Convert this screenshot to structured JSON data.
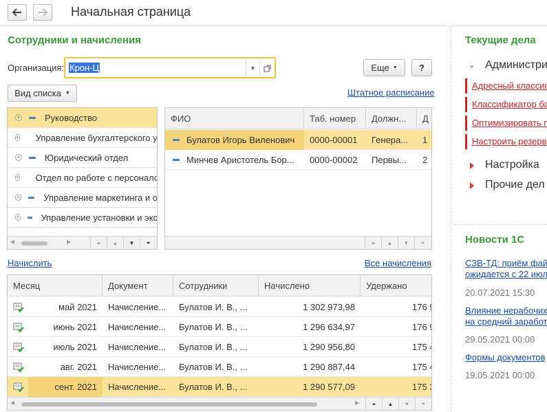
{
  "header": {
    "title": "Начальная страница"
  },
  "section": {
    "title": "Сотрудники и начисления"
  },
  "org": {
    "label": "Организация:",
    "value": "Крон-Ц"
  },
  "buttons": {
    "more": "Еще",
    "help": "?",
    "list_view": "Вид списка"
  },
  "links": {
    "staff_schedule": "Штатное расписание",
    "calculate": "Начислить",
    "all_accruals": "Все начисления"
  },
  "tree": {
    "items": [
      "Руководство",
      "Управление бухгалтерского учета",
      "Юридический отдел",
      "Отдел по работе с персоналом",
      "Управление маркетинга и о",
      "Управление установки и экс"
    ]
  },
  "employees": {
    "columns": [
      "ФИО",
      "Таб. номер",
      "Должн...",
      "Д"
    ],
    "rows": [
      {
        "name": "Булатов Игорь Виленович",
        "tab": "0000-00001",
        "pos": "Генера...",
        "d": "1"
      },
      {
        "name": "Минчев Аристотель Бор...",
        "tab": "0000-00002",
        "pos": "Первы...",
        "d": "2"
      }
    ]
  },
  "accruals": {
    "columns": [
      "Месяц",
      "Документ",
      "Сотрудники",
      "Начислено",
      "Удержано"
    ],
    "rows": [
      {
        "month": "май 2021",
        "doc": "Начисление...",
        "emp": "Булатов И. В., ...",
        "accrued": "1 302 973,98",
        "withheld": "176 9"
      },
      {
        "month": "июнь 2021",
        "doc": "Начисление...",
        "emp": "Булатов И. В., ...",
        "accrued": "1 296 634,97",
        "withheld": "176 9"
      },
      {
        "month": "июль 2021",
        "doc": "Начисление...",
        "emp": "Булатов И. В., ...",
        "accrued": "1 290 956,80",
        "withheld": "175 4"
      },
      {
        "month": "авг. 2021",
        "doc": "Начисление...",
        "emp": "Булатов И. В., ...",
        "accrued": "1 290 887,44",
        "withheld": "175 4"
      },
      {
        "month": "сент. 2021",
        "doc": "Начисление...",
        "emp": "Булатов И. В., ...",
        "accrued": "1 290 577,09",
        "withheld": "175 3"
      }
    ]
  },
  "current": {
    "title": "Текущие дела",
    "admin": "Администри",
    "admin_links": [
      "Адресный классис",
      "Классификатор ба",
      "Оптимизировать п",
      "Настроить резерв"
    ],
    "settings": "Настройка",
    "other": "Прочие дел"
  },
  "news": {
    "title": "Новости 1С",
    "items": [
      {
        "line1": "СЗВ-ТД: приём фай",
        "line2": "ожидается с 22 июл",
        "date": "20.07.2021 15:30"
      },
      {
        "line1": "Влияние нерабочих",
        "line2": "на средний заработ",
        "date": "29.05.2021 00:00"
      },
      {
        "line1": "Формы документов",
        "line2": "",
        "date": "19.05.2021 00:00"
      }
    ]
  },
  "colors": {
    "accent_green": "#3a9a3a",
    "link_blue": "#1b4fa8",
    "selection": "#fbe49a",
    "alert_red": "#c0282a",
    "org_border": "#f0c43c"
  }
}
